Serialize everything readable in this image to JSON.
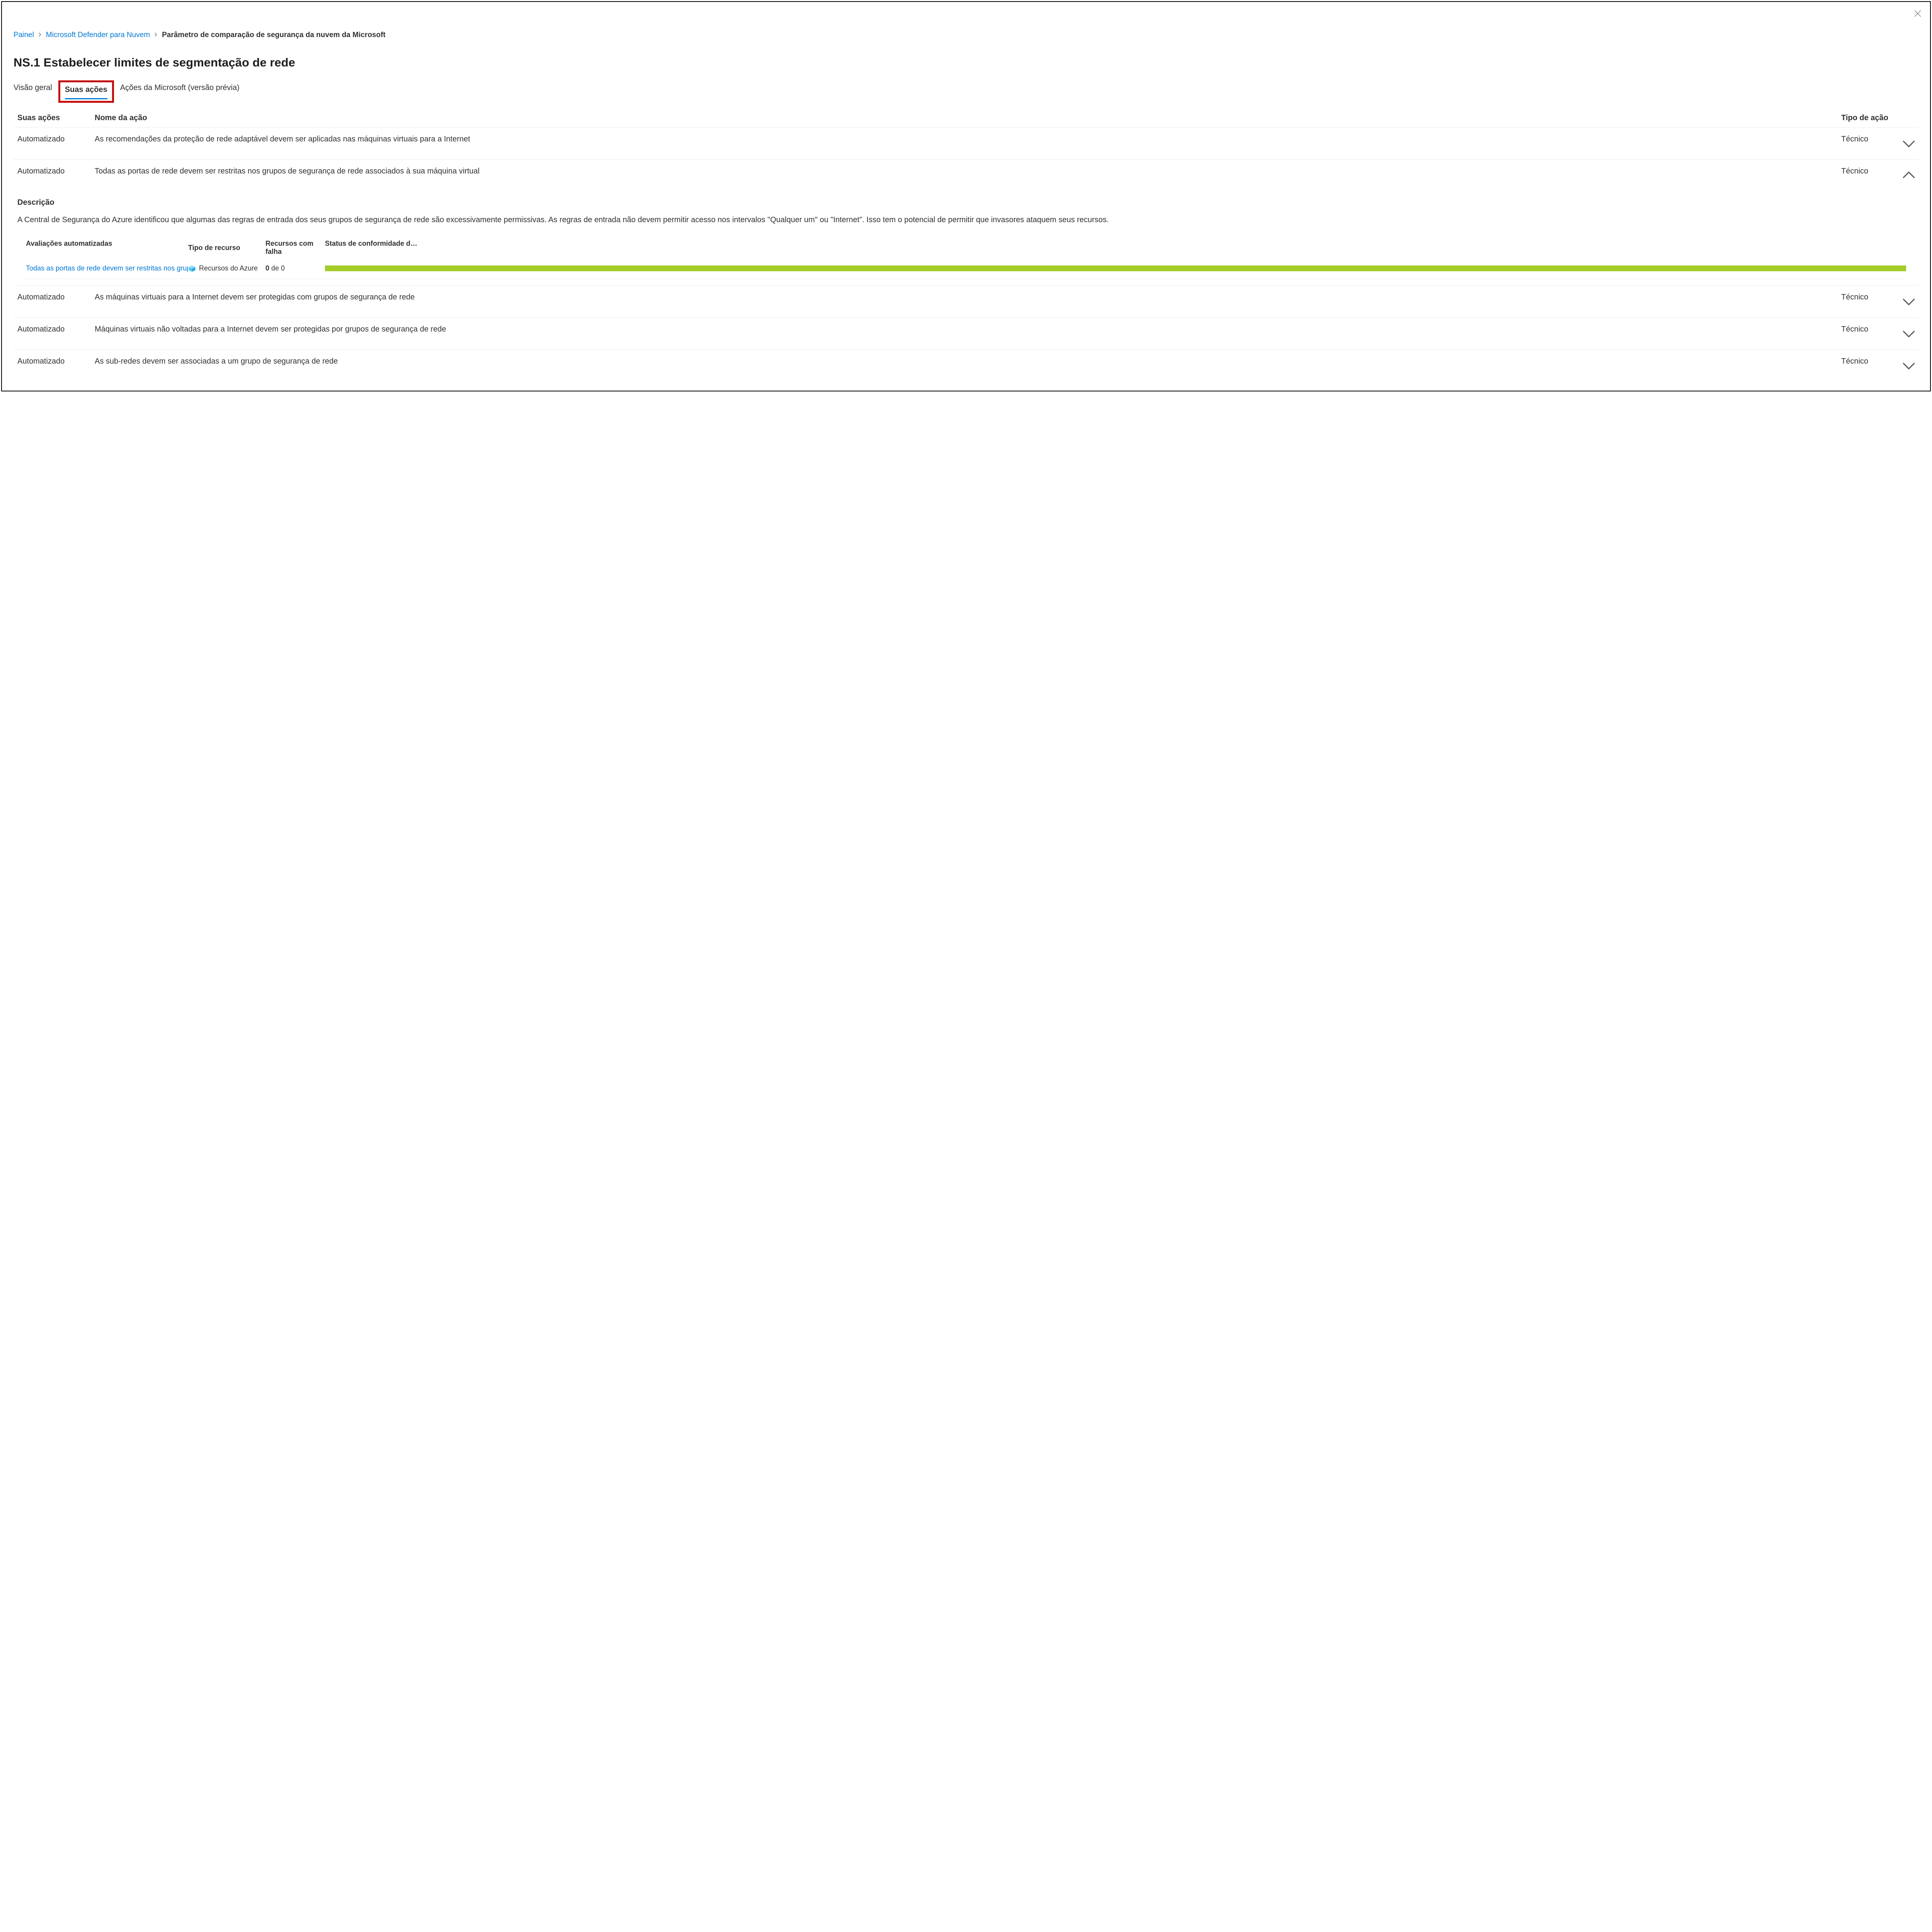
{
  "breadcrumb": {
    "items": [
      {
        "label": "Painel",
        "current": false
      },
      {
        "label": "Microsoft Defender para Nuvem",
        "current": false
      },
      {
        "label": "Parâmetro de comparação de segurança da nuvem da Microsoft",
        "current": true
      }
    ]
  },
  "page_title": "NS.1 Estabelecer limites de segmentação de rede",
  "tabs": {
    "overview": "Visão geral",
    "your_actions": "Suas ações",
    "ms_actions": "Ações da Microsoft (versão prévia)"
  },
  "columns": {
    "your_actions": "Suas ações",
    "action_name": "Nome da ação",
    "action_type": "Tipo de ação"
  },
  "rows": [
    {
      "category": "Automatizado",
      "name": "As recomendações da proteção de rede adaptável devem ser aplicadas nas máquinas virtuais para a Internet",
      "type": "Técnico",
      "expanded": false
    },
    {
      "category": "Automatizado",
      "name": "Todas as portas de rede devem ser restritas nos grupos de segurança de rede associados à sua máquina virtual",
      "type": "Técnico",
      "expanded": true
    },
    {
      "category": "Automatizado",
      "name": "As máquinas virtuais para a Internet devem ser protegidas com grupos de segurança de rede",
      "type": "Técnico",
      "expanded": false
    },
    {
      "category": "Automatizado",
      "name": "Máquinas virtuais não voltadas para a Internet devem ser protegidas por grupos de segurança de rede",
      "type": "Técnico",
      "expanded": false
    },
    {
      "category": "Automatizado",
      "name": "As sub-redes devem ser associadas a um grupo de segurança de rede",
      "type": "Técnico",
      "expanded": false
    }
  ],
  "description": {
    "heading": "Descrição",
    "text": "A Central de Segurança do Azure identificou que algumas das regras de entrada dos seus grupos de segurança de rede são excessivamente permissivas. As regras de entrada não devem permitir acesso nos intervalos \"Qualquer um\" ou \"Internet\". Isso tem o potencial de permitir que invasores ataquem seus recursos."
  },
  "assessments": {
    "cols": {
      "auto": "Avaliações automatizadas",
      "resource": "Tipo de recurso",
      "failed": "Recursos com falha",
      "status": "Status de conformidade d…"
    },
    "row": {
      "name": "Todas as portas de rede devem ser restritas nos grupo",
      "resource": "Recursos do Azure",
      "failed_bold": "0",
      "failed_rest": " de 0"
    }
  }
}
